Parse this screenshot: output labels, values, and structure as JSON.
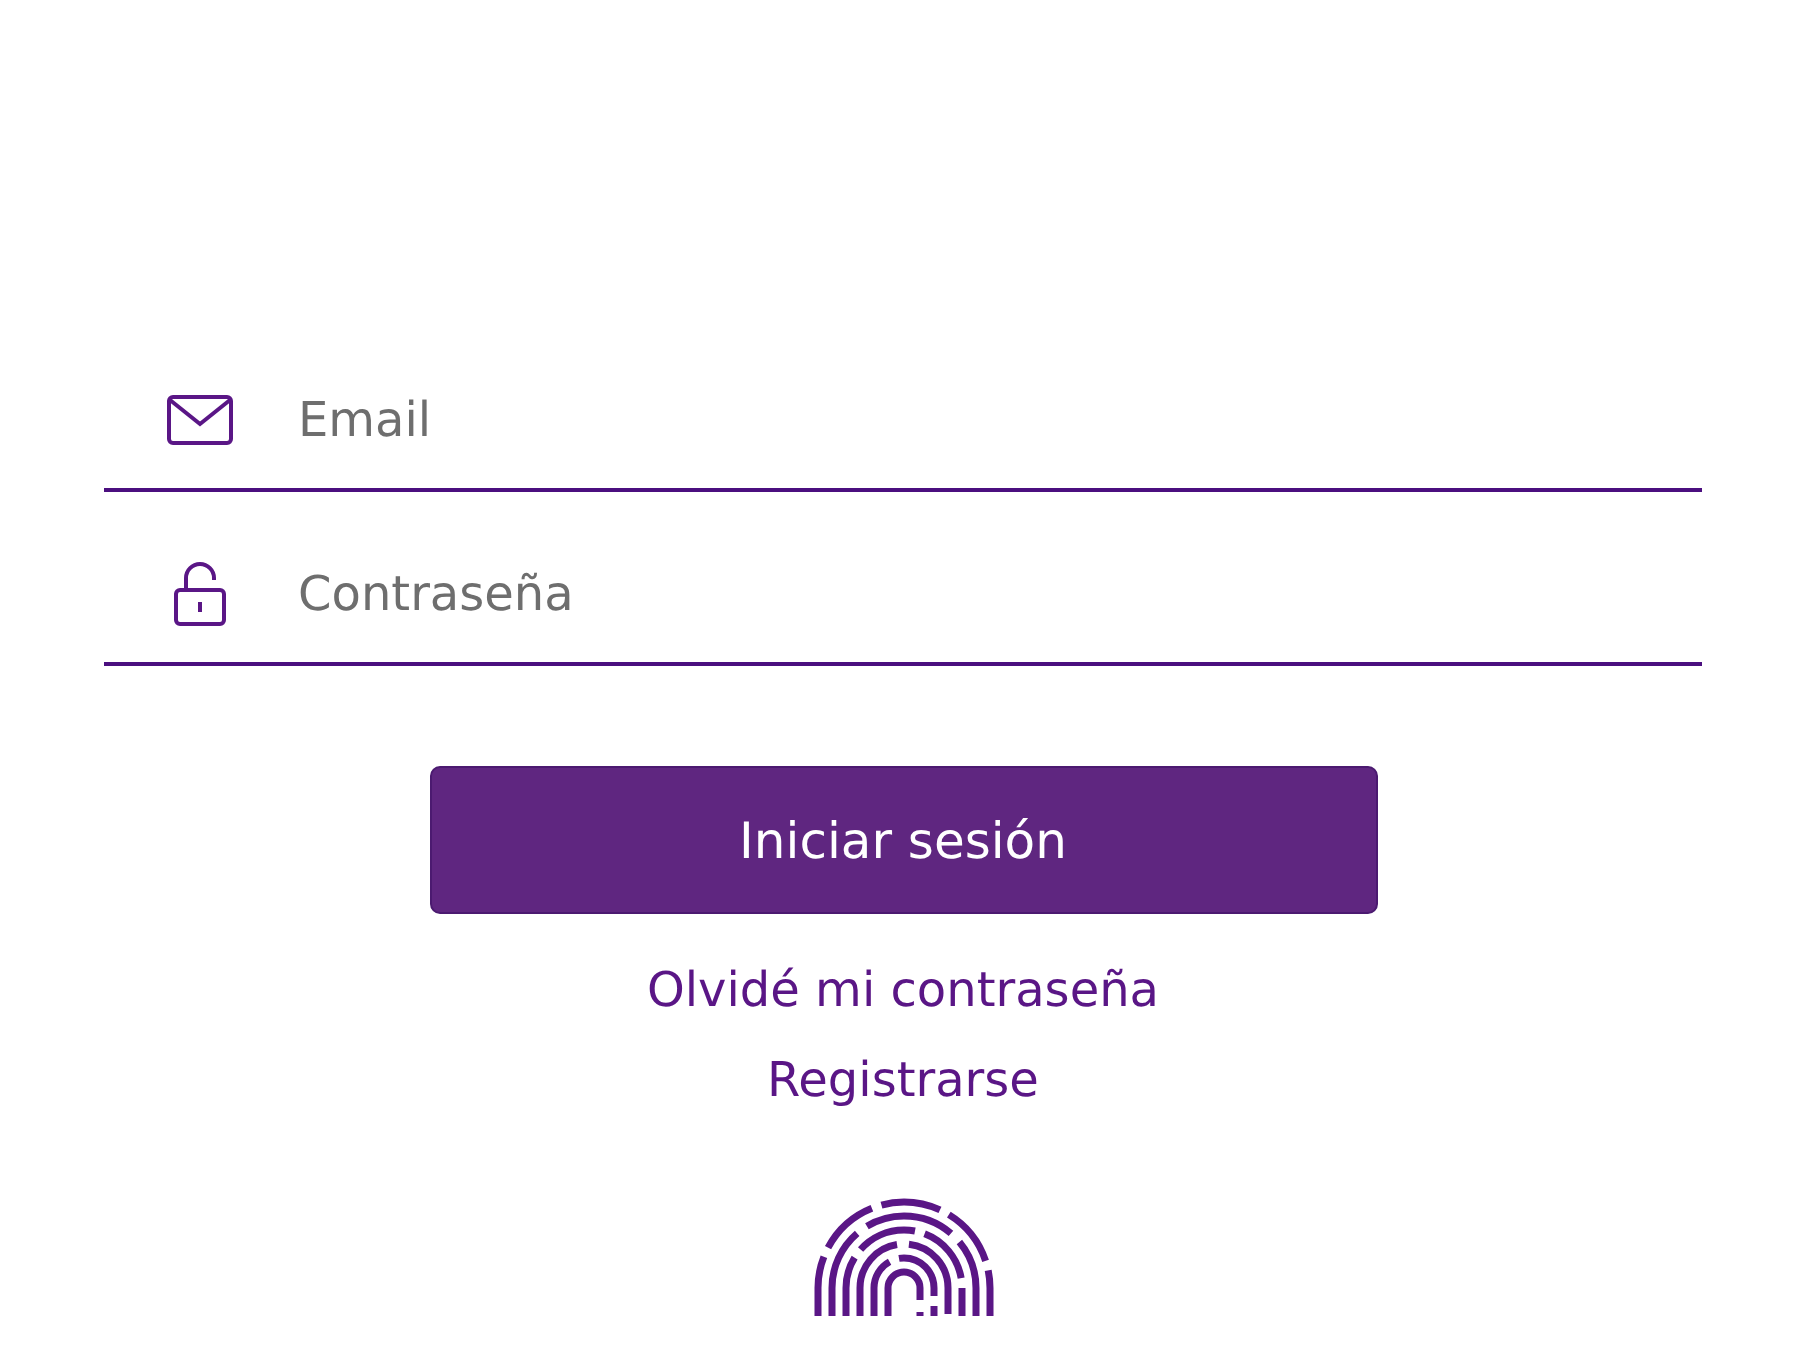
{
  "form": {
    "fields": [
      {
        "kind": "email",
        "placeholder": "Email"
      },
      {
        "kind": "password",
        "placeholder": "Contraseña"
      }
    ],
    "submit": "Iniciar sesión",
    "links": [
      "Olvidé mi contraseña",
      "Registrarse"
    ]
  }
}
